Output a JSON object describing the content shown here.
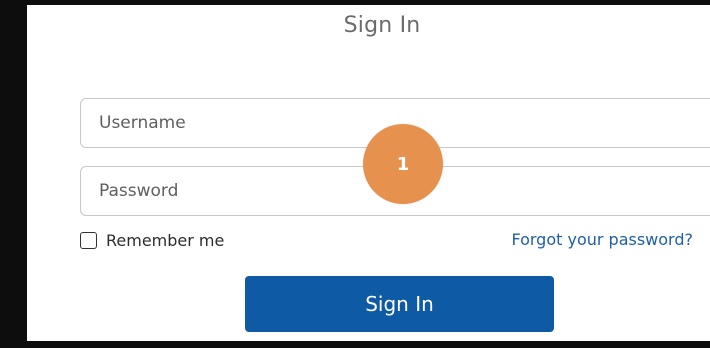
{
  "title": "Sign In",
  "username": {
    "placeholder": "Username",
    "value": ""
  },
  "password": {
    "placeholder": "Password",
    "value": ""
  },
  "callout": {
    "label": "1",
    "color": "#e6914d"
  },
  "remember": {
    "label": "Remember me",
    "checked": false
  },
  "forgot_link": "Forgot your password?",
  "submit_label": "Sign In",
  "colors": {
    "primary": "#0f5aa5",
    "link": "#1f5fa8"
  }
}
